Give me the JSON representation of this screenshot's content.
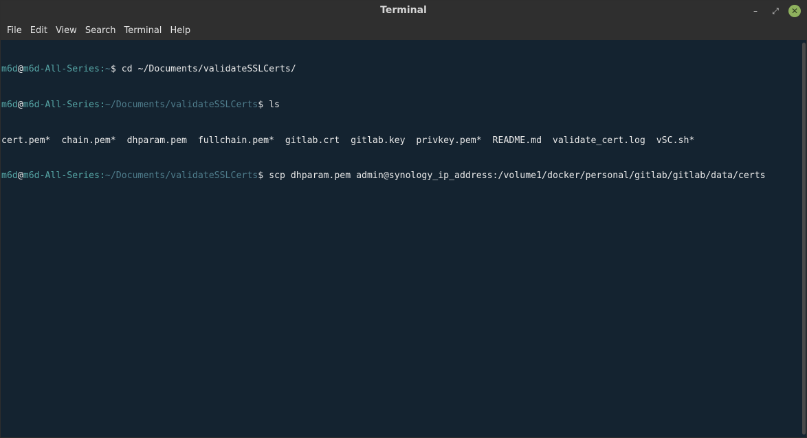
{
  "window": {
    "title": "Terminal",
    "minimize_symbol": "–",
    "maximize_symbol": "⤢",
    "close_symbol": "✕"
  },
  "menu": {
    "file": "File",
    "edit": "Edit",
    "view": "View",
    "search": "Search",
    "terminal": "Terminal",
    "help": "Help"
  },
  "prompt": {
    "user": "m6d",
    "at": "@",
    "host": "m6d-All-Series",
    "colon": ":"
  },
  "lines": {
    "l1": {
      "path": "~",
      "suffix": "$ cd ~/Documents/validateSSLCerts/"
    },
    "l2": {
      "path": "~/Documents/validateSSLCerts",
      "suffix": "$ ls"
    },
    "l3": {
      "text": "cert.pem*  chain.pem*  dhparam.pem  fullchain.pem*  gitlab.crt  gitlab.key  privkey.pem*  README.md  validate_cert.log  vSC.sh*"
    },
    "l4": {
      "path": "~/Documents/validateSSLCerts",
      "suffix": "$ scp dhparam.pem admin@synology_ip_address:/volume1/docker/personal/gitlab/gitlab/data/certs"
    }
  },
  "colors": {
    "background": "#142330",
    "user": "#56a6a6",
    "path": "#4f7d8c",
    "text": "#e8e8e8",
    "close_button": "#8fb25e"
  }
}
